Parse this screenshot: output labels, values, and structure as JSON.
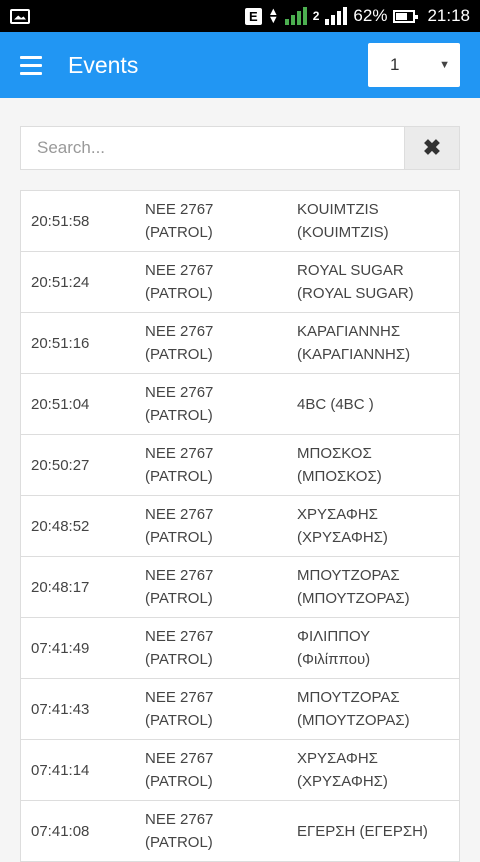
{
  "status": {
    "net_badge": "E",
    "sim2": "2",
    "battery": "62%",
    "time": "21:18"
  },
  "appbar": {
    "title": "Events",
    "select_value": "1"
  },
  "search": {
    "placeholder": "Search..."
  },
  "events": [
    {
      "time": "20:51:58",
      "unit1": "ΝΕΕ 2767",
      "unit2": "(PATROL)",
      "name1": "KOUIMTZIS",
      "name2": "(KOUIMTZIS)"
    },
    {
      "time": "20:51:24",
      "unit1": "ΝΕΕ 2767",
      "unit2": "(PATROL)",
      "name1": "ROYAL SUGAR",
      "name2": "(ROYAL SUGAR)"
    },
    {
      "time": "20:51:16",
      "unit1": "ΝΕΕ 2767",
      "unit2": "(PATROL)",
      "name1": "ΚΑΡΑΓΙΑΝΝΗΣ",
      "name2": "(ΚΑΡΑΓΙΑΝΝΗΣ)"
    },
    {
      "time": "20:51:04",
      "unit1": "ΝΕΕ 2767",
      "unit2": "(PATROL)",
      "name1": "4BC (4BC )",
      "name2": ""
    },
    {
      "time": "20:50:27",
      "unit1": "ΝΕΕ 2767",
      "unit2": "(PATROL)",
      "name1": "ΜΠΟΣΚΟΣ",
      "name2": "(ΜΠΟΣΚΟΣ)"
    },
    {
      "time": "20:48:52",
      "unit1": "ΝΕΕ 2767",
      "unit2": "(PATROL)",
      "name1": "ΧΡΥΣΑΦΗΣ",
      "name2": "(ΧΡΥΣΑΦΗΣ)"
    },
    {
      "time": "20:48:17",
      "unit1": "ΝΕΕ 2767",
      "unit2": "(PATROL)",
      "name1": "ΜΠΟΥΤΖΟΡΑΣ",
      "name2": "(ΜΠΟΥΤΖΟΡΑΣ)"
    },
    {
      "time": "07:41:49",
      "unit1": "ΝΕΕ 2767",
      "unit2": "(PATROL)",
      "name1": "ΦΙΛΙΠΠΟΥ",
      "name2": "(Φιλίππου)"
    },
    {
      "time": "07:41:43",
      "unit1": "ΝΕΕ 2767",
      "unit2": "(PATROL)",
      "name1": "ΜΠΟΥΤΖΟΡΑΣ",
      "name2": "(ΜΠΟΥΤΖΟΡΑΣ)"
    },
    {
      "time": "07:41:14",
      "unit1": "ΝΕΕ 2767",
      "unit2": "(PATROL)",
      "name1": "ΧΡΥΣΑΦΗΣ",
      "name2": "(ΧΡΥΣΑΦΗΣ)"
    },
    {
      "time": "07:41:08",
      "unit1": "ΝΕΕ 2767",
      "unit2": "(PATROL)",
      "name1": "ΕΓΕΡΣΗ (ΕΓΕΡΣΗ)",
      "name2": ""
    }
  ]
}
